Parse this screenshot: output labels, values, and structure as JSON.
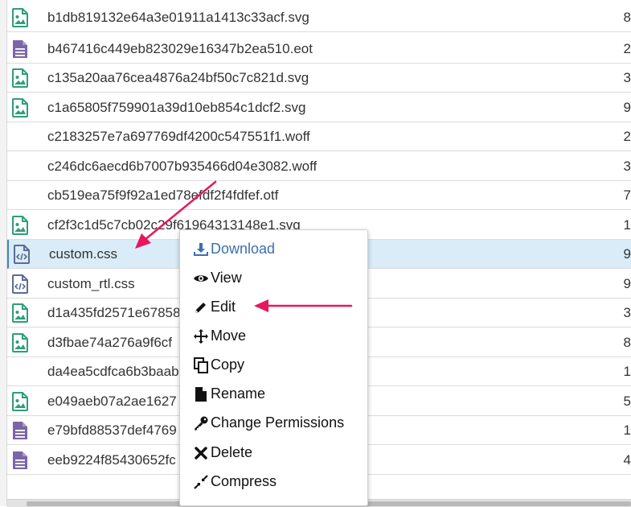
{
  "files": [
    {
      "name": "b1db819132e64a3e01911a1413c33acf.svg",
      "size": "8",
      "icon": "image-file-icon",
      "selected": false
    },
    {
      "name": "b467416c449eb823029e16347b2ea510.eot",
      "size": "2",
      "icon": "text-file-icon",
      "selected": false
    },
    {
      "name": "c135a20aa76cea4876a24bf50c7c821d.svg",
      "size": "3",
      "icon": "image-file-icon",
      "selected": false
    },
    {
      "name": "c1a65805f759901a39d10eb854c1dcf2.svg",
      "size": "9",
      "icon": "image-file-icon",
      "selected": false
    },
    {
      "name": "c2183257e7a697769df4200c547551f1.woff",
      "size": "2",
      "icon": "none",
      "selected": false
    },
    {
      "name": "c246dc6aecd6b7007b935466d04e3082.woff",
      "size": "3",
      "icon": "none",
      "selected": false
    },
    {
      "name": "cb519ea75f9f92a1ed78efdf2f4fdfef.otf",
      "size": "7",
      "icon": "none",
      "selected": false
    },
    {
      "name": "cf2f3c1d5c7cb02c29f61964313148e1.svg",
      "size": "1",
      "icon": "image-file-icon",
      "selected": false
    },
    {
      "name": "custom.css",
      "size": "9",
      "icon": "code-file-icon",
      "selected": true
    },
    {
      "name": "custom_rtl.css",
      "size": "9",
      "icon": "code-file-icon",
      "selected": false
    },
    {
      "name": "d1a435fd2571e67858",
      "size": "3",
      "icon": "image-file-icon",
      "selected": false
    },
    {
      "name": "d3fbae74a276a9f6cf",
      "size": "8",
      "icon": "image-file-icon",
      "selected": false
    },
    {
      "name": "da4ea5cdfca6b3baab",
      "size": "1",
      "icon": "none",
      "selected": false
    },
    {
      "name": "e049aeb07a2ae1627",
      "size": "5",
      "icon": "image-file-icon",
      "selected": false
    },
    {
      "name": "e79bfd88537def4769",
      "size": "1",
      "icon": "text-file-icon",
      "selected": false
    },
    {
      "name": "eeb9224f85430652fc",
      "size": "4",
      "icon": "text-file-icon",
      "selected": false
    }
  ],
  "context_menu": {
    "items": [
      {
        "key": "download",
        "label": "Download",
        "icon": "download-icon"
      },
      {
        "key": "view",
        "label": "View",
        "icon": "eye-icon"
      },
      {
        "key": "edit",
        "label": "Edit",
        "icon": "pencil-icon"
      },
      {
        "key": "move",
        "label": "Move",
        "icon": "move-arrows-icon"
      },
      {
        "key": "copy",
        "label": "Copy",
        "icon": "copy-icon"
      },
      {
        "key": "rename",
        "label": "Rename",
        "icon": "file-icon"
      },
      {
        "key": "change_permissions",
        "label": "Change Permissions",
        "icon": "key-icon"
      },
      {
        "key": "delete",
        "label": "Delete",
        "icon": "close-x-icon"
      },
      {
        "key": "compress",
        "label": "Compress",
        "icon": "compress-icon"
      }
    ]
  },
  "colors": {
    "image_icon": "#2f9e78",
    "text_icon": "#7b65a8",
    "code_icon": "#5b6d96",
    "selected_row": "#d9ecf7",
    "active_menu_text": "#3a6fb0",
    "annotation_arrow": "#e8175d"
  }
}
